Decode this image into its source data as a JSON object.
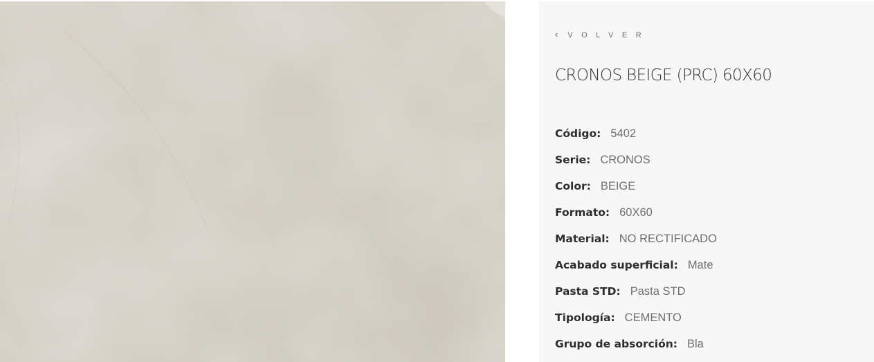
{
  "product": {
    "back_label": "VOLVER",
    "back_icon": "chevron-left-icon",
    "title": "CRONOS BEIGE (PRC) 60X60",
    "image_alt": "CRONOS BEIGE",
    "specs": [
      {
        "label": "Código:",
        "value": "5402"
      },
      {
        "label": "Serie:",
        "value": "CRONOS"
      },
      {
        "label": "Color:",
        "value": "BEIGE"
      },
      {
        "label": "Formato:",
        "value": "60X60"
      },
      {
        "label": "Material:",
        "value": "NO RECTIFICADO"
      },
      {
        "label": "Acabado superficial:",
        "value": "Mate"
      },
      {
        "label": "Pasta STD:",
        "value": "Pasta STD"
      },
      {
        "label": "Tipología:",
        "value": "CEMENTO"
      },
      {
        "label": "Grupo de absorción:",
        "value": "Bla"
      }
    ]
  },
  "colors": {
    "tile_base": "#d4d0c6",
    "panel_background": "#f7f7f7",
    "label_text": "#2e2e2e",
    "value_text": "#6f6f6f"
  }
}
